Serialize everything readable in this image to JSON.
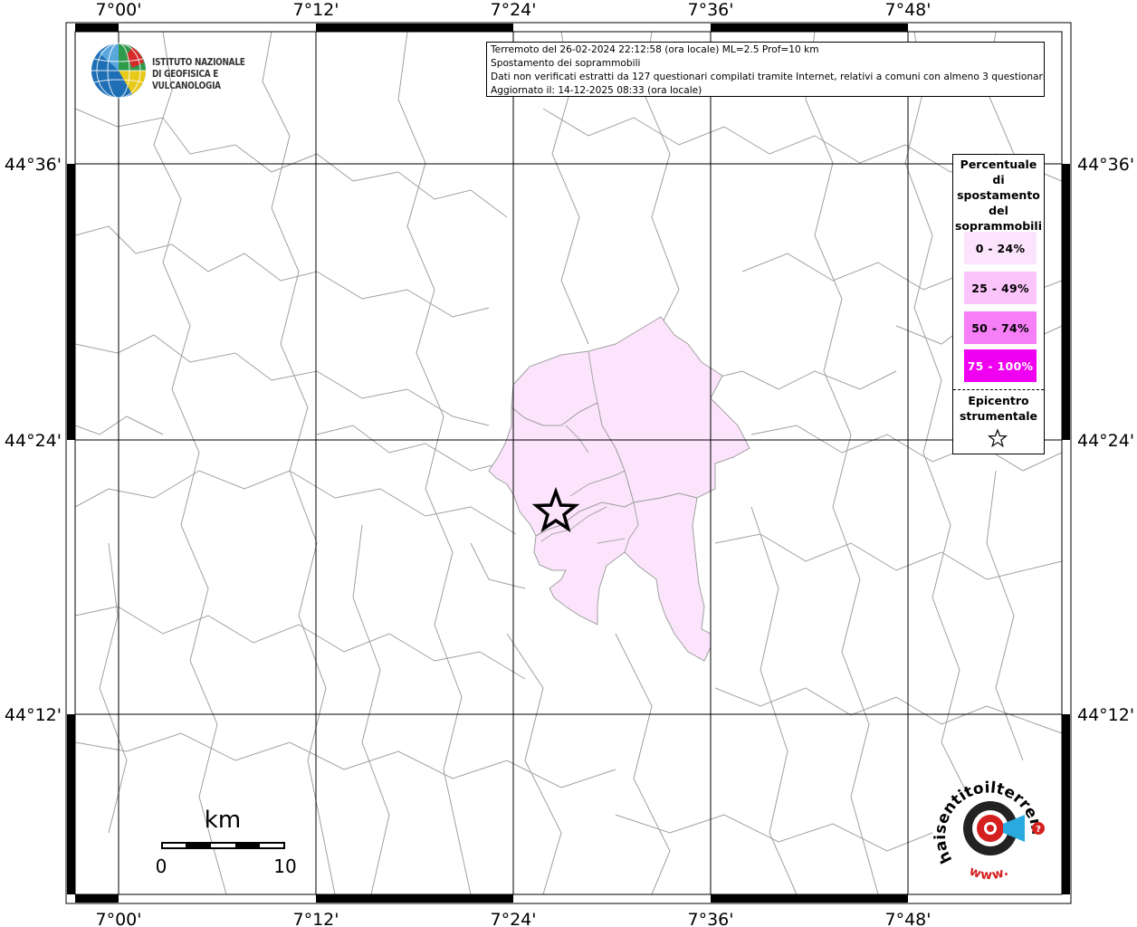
{
  "map": {
    "lon_ticks": [
      "7°00'",
      "7°12'",
      "7°24'",
      "7°36'",
      "7°48'"
    ],
    "lat_ticks": [
      "44°36'",
      "44°24'",
      "44°12'"
    ]
  },
  "info": {
    "line1": "Terremoto del 26-02-2024 22:12:58 (ora locale) ML=2.5 Prof=10 km",
    "line2": "Spostamento dei soprammobili",
    "line3": "Dati non verificati estratti da 127 questionari compilati tramite Internet, relativi a comuni con almeno 3 questionari.",
    "line4": "Aggiornato il: 14-12-2025 08:33 (ora locale)"
  },
  "logo": {
    "line1": "ISTITUTO NAZIONALE",
    "line2": "DI GEOFISICA E VULCANOLOGIA"
  },
  "legend": {
    "title": [
      "Percentuale",
      "di",
      "spostamento",
      "del",
      "soprammobili"
    ],
    "items": [
      {
        "label": "0 - 24%",
        "color": "#fce4fc",
        "text_color": "#000000"
      },
      {
        "label": "25 - 49%",
        "color": "#fbc4fb",
        "text_color": "#000000"
      },
      {
        "label": "50 - 74%",
        "color": "#f67ef6",
        "text_color": "#000000"
      },
      {
        "label": "75 - 100%",
        "color": "#f000f0",
        "text_color": "#ffffff"
      }
    ],
    "epicenter_label": [
      "Epicentro",
      "strumentale"
    ]
  },
  "scale": {
    "unit": "km",
    "min_label": "0",
    "max_label": "10"
  },
  "badge": {
    "text": "haisentitoilterremoto.it",
    "www": "www."
  },
  "colors": {
    "affected_area": "#fce4fc",
    "boundary": "#9a9a9a",
    "grid": "#000000"
  }
}
